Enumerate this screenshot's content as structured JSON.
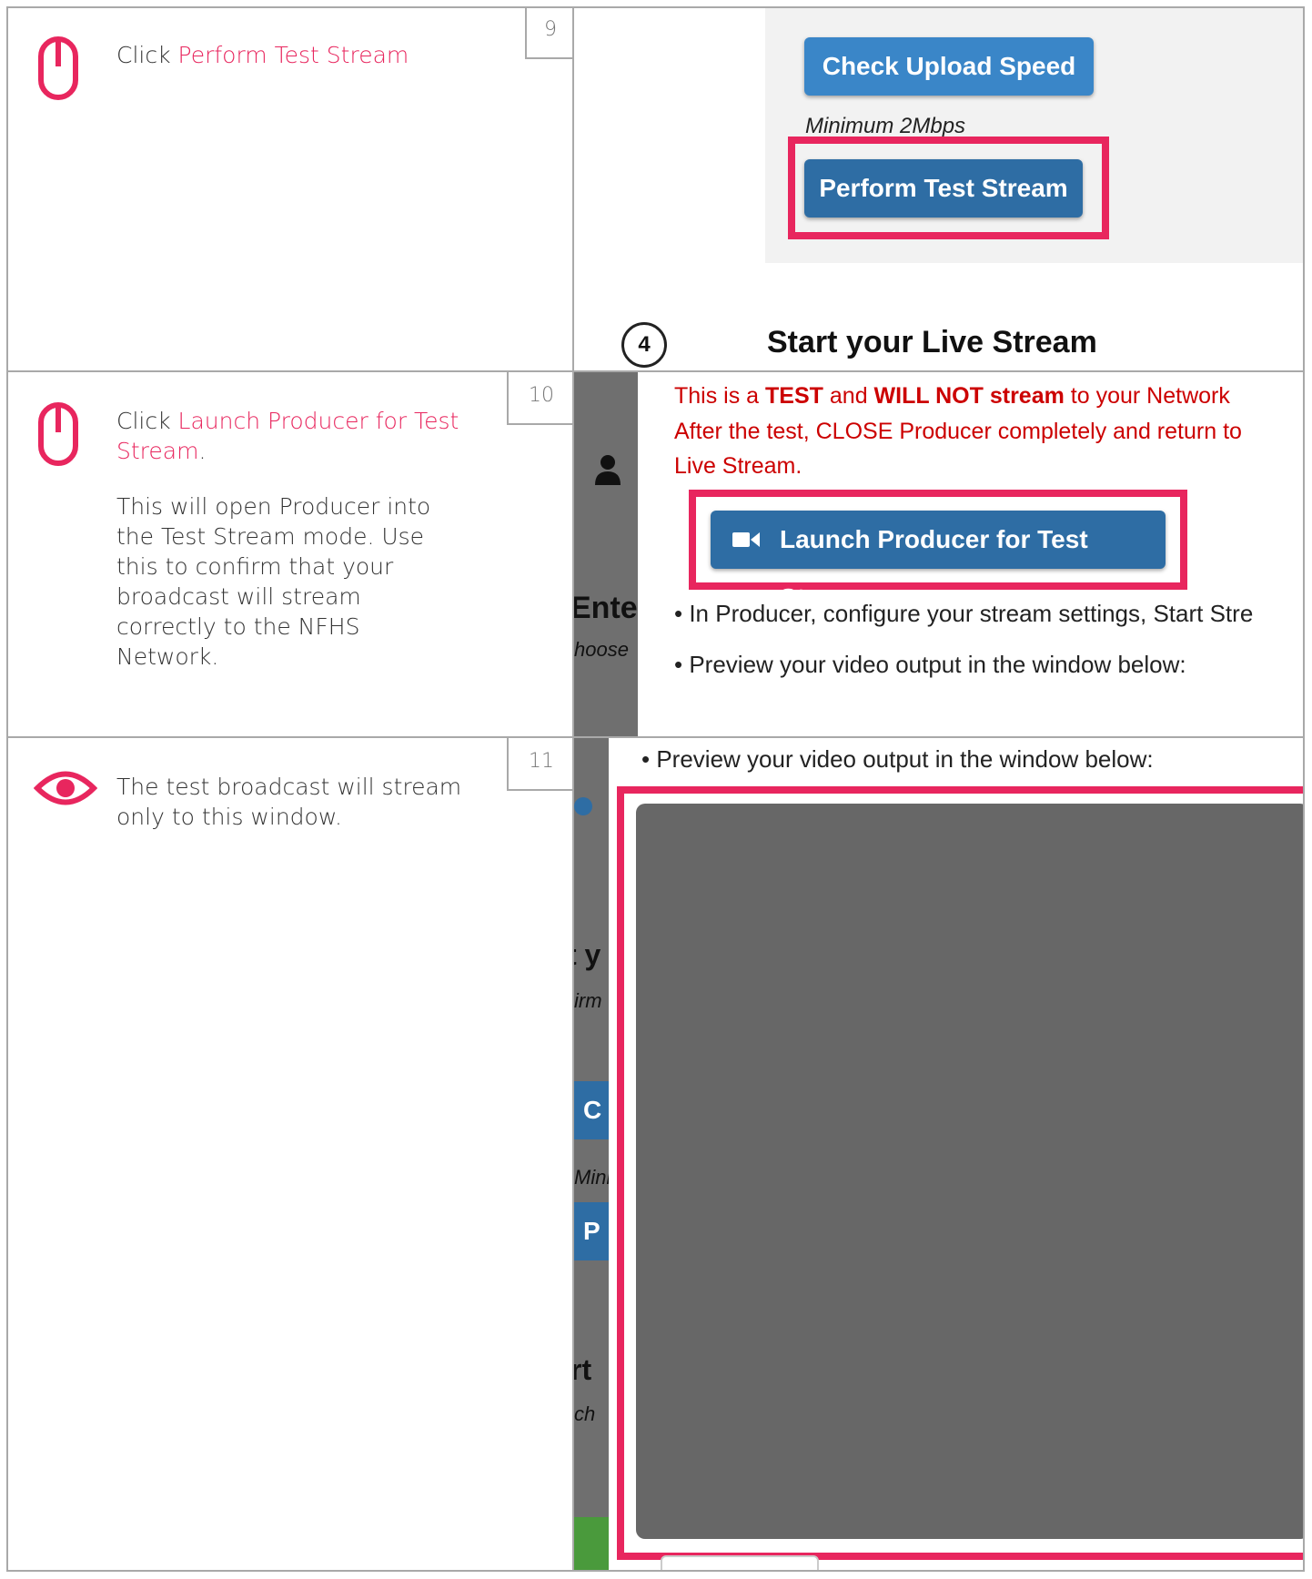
{
  "steps": [
    {
      "number": "9",
      "prefix": "Click ",
      "link": "Perform Test Stream",
      "shot": {
        "check_button": "Check Upload Speed",
        "minimum": "Minimum 2Mbps",
        "perform_button": "Perform Test Stream",
        "section_number": "4",
        "section_title": "Start your Live Stream"
      }
    },
    {
      "number": "10",
      "prefix": "Click  ",
      "link": "Launch Producer for Test Stream",
      "suffix": ".",
      "body": "This will open Producer into the Test Stream mode. Use this to confirm that your broadcast will stream correctly to the NFHS Network.",
      "shot": {
        "warning_1": "This is a ",
        "warning_test": "TEST",
        "warning_2": " and ",
        "warning_will_not": "WILL NOT stream",
        "warning_3": " to your Network",
        "warning_line2": "After the test, CLOSE Producer completely and return to",
        "warning_line3": "Live Stream.",
        "launch_button": "Launch Producer for Test Stream",
        "bullet_1": "In Producer, configure your stream settings, Start Stre",
        "bullet_2": "Preview your video output in the window below:",
        "bg_text_1": "Enter",
        "bg_text_2": "hoose"
      }
    },
    {
      "number": "11",
      "body": "The test broadcast will stream only to this window.",
      "shot": {
        "bullet": "Preview your video output in the window below:",
        "bg_text_1": "t y",
        "bg_text_2": "irm",
        "bg_text_3": "C",
        "bg_text_4": "Mini",
        "bg_text_5": "P",
        "bg_text_6": "rt",
        "bg_text_7": "ch"
      }
    }
  ],
  "colors": {
    "accent": "#e8265e",
    "button_blue": "#2e6da4",
    "button_blue_light": "#3a86c8",
    "warning_red": "#cc0000",
    "preview_gray": "#676767"
  },
  "icons": [
    "mouse-icon",
    "mouse-icon",
    "eye-icon",
    "video-camera-icon",
    "user-icon"
  ]
}
